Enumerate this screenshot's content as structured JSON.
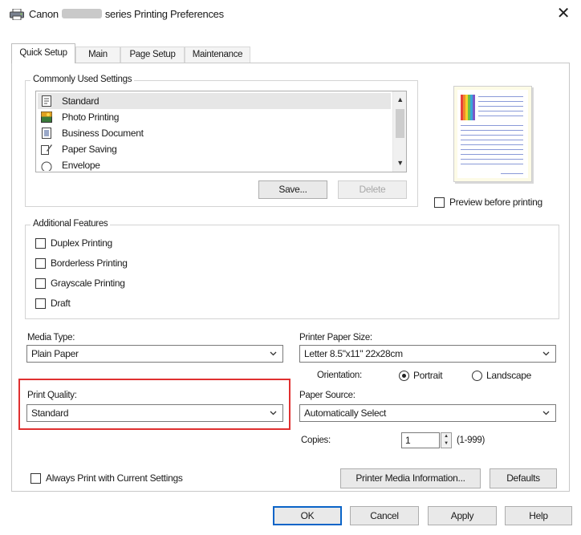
{
  "window": {
    "title_prefix": "Canon",
    "title_suffix": "series Printing Preferences",
    "close_glyph": "✕"
  },
  "tabs": [
    {
      "label": "Quick Setup",
      "active": true
    },
    {
      "label": "Main",
      "active": false
    },
    {
      "label": "Page Setup",
      "active": false
    },
    {
      "label": "Maintenance",
      "active": false
    }
  ],
  "commonly_used": {
    "group_title": "Commonly Used Settings",
    "items": [
      {
        "label": "Standard",
        "icon": "standard-doc-icon",
        "selected": true
      },
      {
        "label": "Photo Printing",
        "icon": "photo-icon",
        "selected": false
      },
      {
        "label": "Business Document",
        "icon": "business-doc-icon",
        "selected": false
      },
      {
        "label": "Paper Saving",
        "icon": "paper-saving-icon",
        "selected": false
      },
      {
        "label": "Envelope",
        "icon": "envelope-icon",
        "selected": false
      }
    ],
    "save_label": "Save...",
    "delete_label": "Delete"
  },
  "preview": {
    "checkbox_label": "Preview before printing",
    "checked": false
  },
  "additional_features": {
    "group_title": "Additional Features",
    "items": [
      {
        "label": "Duplex Printing",
        "checked": false
      },
      {
        "label": "Borderless Printing",
        "checked": false
      },
      {
        "label": "Grayscale Printing",
        "checked": false
      },
      {
        "label": "Draft",
        "checked": false
      }
    ]
  },
  "media_type": {
    "label": "Media Type:",
    "value": "Plain Paper"
  },
  "printer_paper_size": {
    "label": "Printer Paper Size:",
    "value": "Letter 8.5\"x11\" 22x28cm"
  },
  "orientation": {
    "label": "Orientation:",
    "options": [
      {
        "label": "Portrait",
        "selected": true
      },
      {
        "label": "Landscape",
        "selected": false
      }
    ]
  },
  "print_quality": {
    "label": "Print Quality:",
    "value": "Standard"
  },
  "paper_source": {
    "label": "Paper Source:",
    "value": "Automatically Select"
  },
  "copies": {
    "label": "Copies:",
    "value": "1",
    "range": "(1-999)"
  },
  "always_print": {
    "label": "Always Print with Current Settings",
    "checked": false
  },
  "buttons": {
    "media_info": "Printer Media Information...",
    "defaults": "Defaults",
    "ok": "OK",
    "cancel": "Cancel",
    "apply": "Apply",
    "help": "Help"
  },
  "colors": {
    "highlight": "#e03030",
    "selection": "#e6e6e6",
    "accent": "#0a64c8"
  }
}
